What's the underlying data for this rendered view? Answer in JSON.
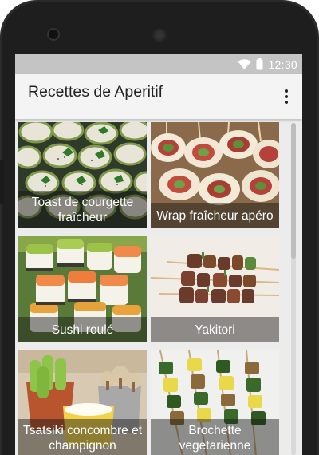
{
  "status_bar": {
    "time": "12:30",
    "icons": [
      "wifi-icon",
      "battery-icon"
    ]
  },
  "app_bar": {
    "title": "Recettes de Aperitif",
    "overflow_icon": "more-vert-icon"
  },
  "recipes": [
    {
      "caption": "Toast de courgette fraîcheur",
      "image": "zucchini-toast-image"
    },
    {
      "caption": "Wrap fraîcheur apéro",
      "image": "wrap-rolls-image"
    },
    {
      "caption": "Sushi roulé",
      "image": "sushi-roll-image"
    },
    {
      "caption": "Yakitori",
      "image": "yakitori-skewers-image"
    },
    {
      "caption": "Tsatsiki concombre et champignon",
      "image": "tzatziki-cucumber-mushroom-image"
    },
    {
      "caption": "Brochette vegetarienne",
      "image": "vegetarian-skewers-image"
    }
  ],
  "colors": {
    "status_bar": "#c4c4c4",
    "app_bar": "#f4f4f4",
    "phone_frame": "#1e1e1e"
  }
}
